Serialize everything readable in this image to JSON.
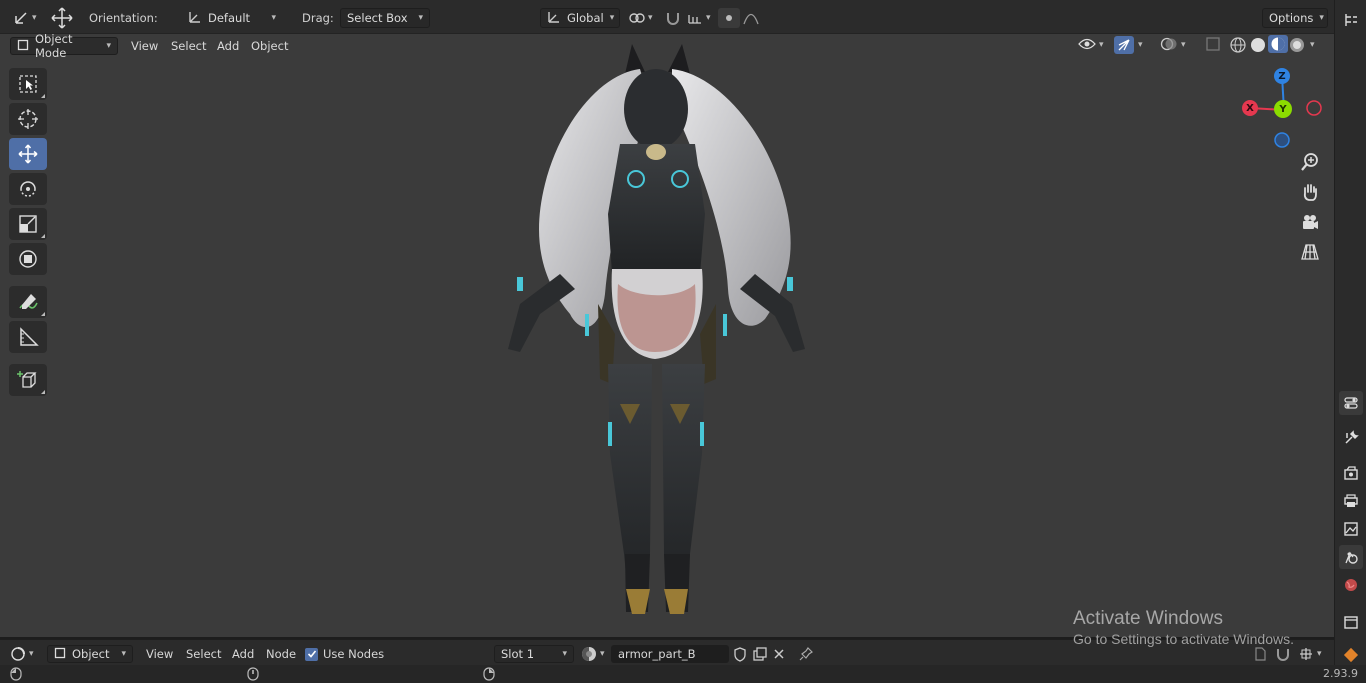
{
  "topbar": {
    "orientation_label": "Orientation:",
    "orientation_value": "Default",
    "drag_label": "Drag:",
    "drag_value": "Select Box",
    "transform_space": "Global",
    "options_label": "Options"
  },
  "viewport_header": {
    "mode": "Object Mode",
    "menu": [
      "View",
      "Select",
      "Add",
      "Object"
    ]
  },
  "toolbar_icons": [
    "select-box-icon",
    "cursor-icon",
    "move-icon",
    "rotate-icon",
    "scale-icon",
    "transform-icon",
    "annotate-icon",
    "measure-icon",
    "add-cube-icon"
  ],
  "gizmo": {
    "x": "X",
    "y": "Y",
    "z": "Z",
    "x_color": "#e5384f",
    "y_color": "#8bdc00",
    "z_color": "#2f83e3"
  },
  "shader_editor": {
    "object_type": "Object",
    "menu": [
      "View",
      "Select",
      "Add",
      "Node"
    ],
    "use_nodes_label": "Use Nodes",
    "use_nodes_checked": true,
    "slot": "Slot 1",
    "material_name": "armor_part_B"
  },
  "watermark": {
    "line1": "Activate Windows",
    "line2": "Go to Settings to activate Windows."
  },
  "status": {
    "version": "2.93.9"
  },
  "colors": {
    "accent": "#4f6fa7",
    "viewport_bg": "#3b3b3b",
    "header_bg": "#2b2b2b"
  }
}
